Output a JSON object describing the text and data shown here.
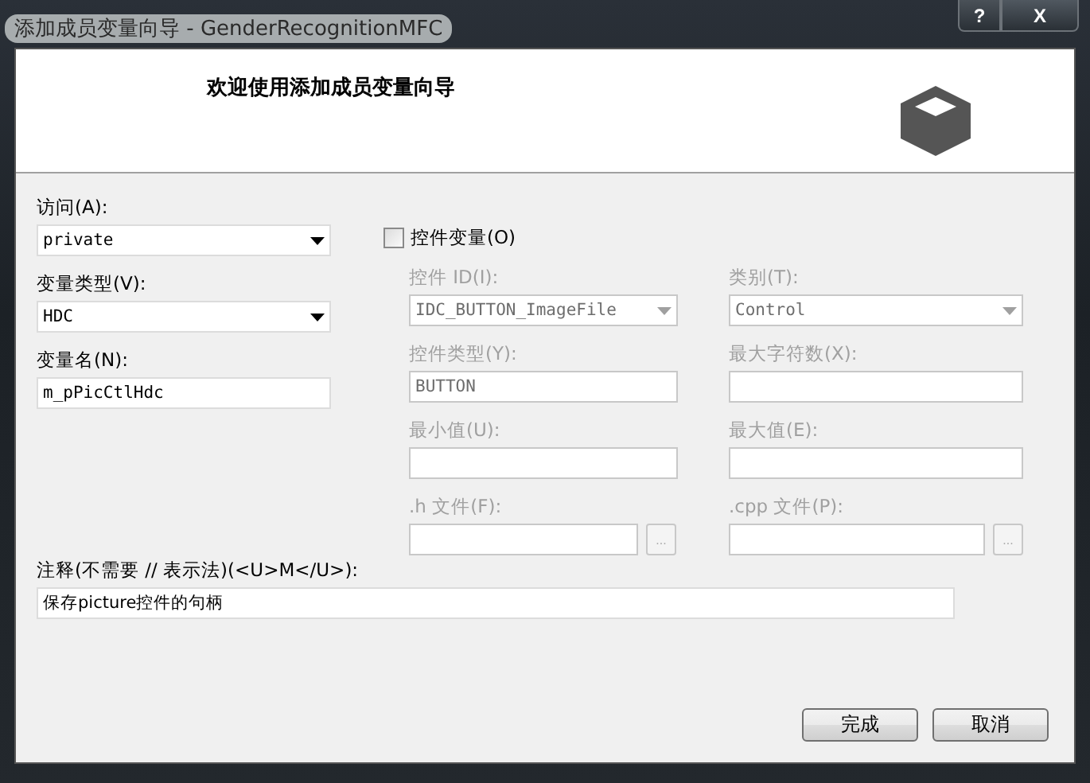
{
  "window": {
    "title": "添加成员变量向导 - GenderRecognitionMFC",
    "buttons": [
      {
        "kind": "help",
        "label": "?"
      },
      {
        "kind": "close",
        "label": "X"
      }
    ]
  },
  "header": {
    "title": "欢迎使用添加成员变量向导"
  },
  "left_fields": [
    {
      "kind": "dropdown",
      "label": "访问(A):",
      "value": "private"
    },
    {
      "kind": "dropdown",
      "label": "变量类型(V):",
      "value": "HDC"
    },
    {
      "kind": "text",
      "label": "变量名(N):",
      "value": "m_pPicCtlHdc"
    }
  ],
  "control_variable": {
    "label": "控件变量(O)",
    "checked": false
  },
  "control_fields": [
    {
      "kind": "dropdown",
      "label": "控件 ID(I):",
      "value": "IDC_BUTTON_ImageFile",
      "disabled": true
    },
    {
      "kind": "dropdown",
      "label": "类别(T):",
      "value": "Control",
      "disabled": true
    },
    {
      "kind": "text",
      "label": "控件类型(Y):",
      "value": "BUTTON",
      "disabled": true
    },
    {
      "kind": "text",
      "label": "最大字符数(X):",
      "disabled": true
    },
    {
      "kind": "text",
      "label": "最小值(U):",
      "disabled": true
    },
    {
      "kind": "text",
      "label": "最大值(E):",
      "disabled": true
    },
    {
      "kind": "file",
      "label": ".h 文件(F):",
      "browse": "...",
      "disabled": true
    },
    {
      "kind": "file",
      "label": ".cpp 文件(P):",
      "browse": "...",
      "disabled": true
    }
  ],
  "notes": {
    "label": "注释(不需要 // 表示法)(<U>M</U>):",
    "value": "保存picture控件的句柄"
  },
  "buttons": [
    "完成",
    "取消"
  ]
}
